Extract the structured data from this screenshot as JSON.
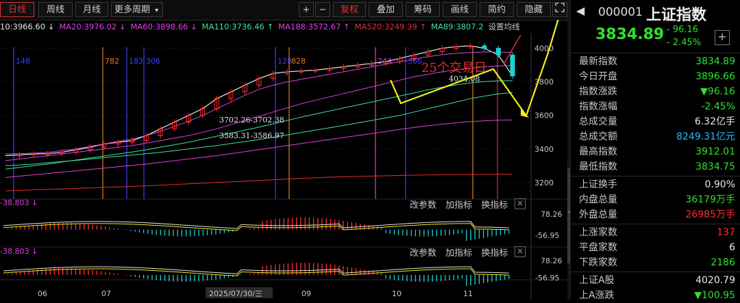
{
  "toolbar": {
    "tabs": [
      "日线",
      "周线",
      "月线",
      "更多周期"
    ],
    "more_arrow": "▾",
    "buttons": [
      "+",
      "−",
      "复权",
      "叠加",
      "筹码",
      "画线",
      "简约",
      "隐藏"
    ],
    "fullscreen_icon": "expand-icon"
  },
  "ma_bar": [
    {
      "text": "10:3966.60 ↓",
      "color": "#e8e8e8"
    },
    {
      "text": "MA20:3976.02 ↓",
      "color": "#e040e0"
    },
    {
      "text": "MA60:3898.66 ↓",
      "color": "#e040e0"
    },
    {
      "text": "MA110:3736.46 ↑",
      "color": "#40e0a0"
    },
    {
      "text": "MA188:3572.67 ↑",
      "color": "#e040e0"
    },
    {
      "text": "MA520:3249.39 ↑",
      "color": "#e03030"
    },
    {
      "text": "MA89:3807.2",
      "color": "#40e0a0"
    },
    {
      "text": "设置均线",
      "color": "#c8c8c8"
    }
  ],
  "chart_data": {
    "type": "line",
    "title": "上证指数",
    "x_ticks": [
      "06",
      "07",
      "2025/07/30/三",
      "09",
      "10",
      "11"
    ],
    "y_ticks": [
      3200,
      3400,
      3600,
      3800,
      4000
    ],
    "ylim": [
      3130,
      4080
    ],
    "series": [
      {
        "name": "上证指数",
        "color": "#e8e8e8",
        "values": [
          3360,
          3365,
          3370,
          3372,
          3380,
          3395,
          3410,
          3430,
          3440,
          3450,
          3480,
          3520,
          3560,
          3600,
          3640,
          3700,
          3740,
          3780,
          3820,
          3850,
          3860,
          3865,
          3870,
          3880,
          3890,
          3900,
          3910,
          3920,
          3940,
          3960,
          3980,
          4000,
          4010,
          4015,
          4000,
          3960,
          3834.89
        ]
      },
      {
        "name": "MA20",
        "color": "#e040e0",
        "values": [
          3370,
          3372,
          3375,
          3380,
          3390,
          3400,
          3415,
          3430,
          3445,
          3460,
          3480,
          3505,
          3535,
          3565,
          3600,
          3640,
          3680,
          3720,
          3755,
          3780,
          3800,
          3815,
          3830,
          3845,
          3860,
          3875,
          3890,
          3905,
          3920,
          3935,
          3950,
          3962,
          3970,
          3975,
          3978,
          3977,
          3976
        ]
      },
      {
        "name": "MA60",
        "color": "#e040e0",
        "values": [
          3330,
          3340,
          3350,
          3360,
          3370,
          3380,
          3390,
          3400,
          3410,
          3420,
          3435,
          3450,
          3465,
          3480,
          3500,
          3520,
          3545,
          3570,
          3595,
          3620,
          3645,
          3670,
          3690,
          3710,
          3730,
          3750,
          3770,
          3790,
          3810,
          3830,
          3845,
          3860,
          3872,
          3882,
          3890,
          3895,
          3898.66
        ]
      },
      {
        "name": "MA110",
        "color": "#40e0a0",
        "values": [
          3300,
          3305,
          3310,
          3318,
          3325,
          3332,
          3340,
          3348,
          3356,
          3364,
          3372,
          3380,
          3390,
          3400,
          3410,
          3420,
          3432,
          3444,
          3456,
          3470,
          3484,
          3498,
          3512,
          3526,
          3540,
          3555,
          3570,
          3585,
          3600,
          3620,
          3640,
          3660,
          3680,
          3700,
          3715,
          3728,
          3736.46
        ]
      },
      {
        "name": "MA188",
        "color": "#e040e0",
        "values": [
          3230,
          3238,
          3246,
          3254,
          3262,
          3270,
          3278,
          3286,
          3294,
          3302,
          3310,
          3320,
          3330,
          3340,
          3350,
          3360,
          3372,
          3384,
          3396,
          3408,
          3420,
          3432,
          3444,
          3456,
          3468,
          3480,
          3492,
          3504,
          3516,
          3528,
          3538,
          3548,
          3556,
          3563,
          3568,
          3571,
          3572.67
        ]
      },
      {
        "name": "MA520",
        "color": "#e03030",
        "values": [
          3150,
          3153,
          3156,
          3159,
          3162,
          3165,
          3168,
          3171,
          3174,
          3177,
          3180,
          3184,
          3188,
          3192,
          3196,
          3200,
          3204,
          3208,
          3212,
          3216,
          3220,
          3224,
          3228,
          3232,
          3234,
          3236,
          3238,
          3240,
          3242,
          3244,
          3245,
          3246,
          3247,
          3248,
          3248.5,
          3249,
          3249.39
        ]
      },
      {
        "name": "MA89",
        "color": "#40e0a0",
        "values": [
          3280,
          3290,
          3300,
          3310,
          3322,
          3334,
          3346,
          3358,
          3370,
          3382,
          3395,
          3410,
          3425,
          3440,
          3458,
          3476,
          3494,
          3512,
          3530,
          3550,
          3570,
          3590,
          3608,
          3626,
          3644,
          3662,
          3680,
          3698,
          3716,
          3734,
          3752,
          3768,
          3782,
          3794,
          3802,
          3806,
          3807.2
        ]
      }
    ],
    "vertical_markers": [
      {
        "label": "148",
        "color": "#4040ff"
      },
      {
        "label": "782",
        "color": "#e08020"
      },
      {
        "label": "183",
        "color": "#4040ff"
      },
      {
        "label": "306",
        "color": "#4040ff"
      },
      {
        "label": "128",
        "color": "#4040ff"
      },
      {
        "label": "828",
        "color": "#e08020"
      },
      {
        "label": "244",
        "color": "#e040e0"
      },
      {
        "label": "366",
        "color": "#4040ff"
      },
      {
        "label": "",
        "color": "#e08020"
      },
      {
        "label": "",
        "color": "#e03030"
      }
    ],
    "annotations": [
      "3702.26-3702.38",
      "3583.31-3586.97",
      "4034.08",
      "25个交易日"
    ]
  },
  "sub1": {
    "value": "-38.803 ↓",
    "tools": [
      "改参数",
      "加指标",
      "换指标"
    ],
    "close": "×",
    "y_top": "78.26",
    "y_bottom": "-56.95"
  },
  "sub2": {
    "value": "-38.803 ↓",
    "tools": [
      "改参数",
      "加指标",
      "换指标"
    ],
    "close": "×",
    "y_top": "78.26",
    "y_bottom": "-56.95"
  },
  "panel": {
    "code": "000001",
    "name": "上证指数",
    "price": "3834.89",
    "change": "- 96.16",
    "change_pct": "- 2.45%",
    "add_icon": "plus-icon",
    "rows_a": [
      {
        "label": "最新指数",
        "value": "3834.89",
        "color": "#30e030"
      },
      {
        "label": "今日开盘",
        "value": "3896.66",
        "color": "#30e030"
      },
      {
        "label": "指数涨跌",
        "value": "▼96.16",
        "color": "#30e030"
      },
      {
        "label": "指数涨幅",
        "value": "-2.45%",
        "color": "#30e030"
      },
      {
        "label": "总成交量",
        "value": "6.32亿手",
        "color": "#e8e8e8"
      },
      {
        "label": "总成交额",
        "value": "8249.31亿元",
        "color": "#20c0ff"
      },
      {
        "label": "最高指数",
        "value": "3912.01",
        "color": "#30e030"
      },
      {
        "label": "最低指数",
        "value": "3834.75",
        "color": "#30e030"
      }
    ],
    "rows_b": [
      {
        "label": "上证换手",
        "value": "0.90%",
        "color": "#e8e8e8"
      },
      {
        "label": "内盘总量",
        "value": "36179万手",
        "color": "#30e030"
      },
      {
        "label": "外盘总量",
        "value": "26985万手",
        "color": "#ff3030"
      }
    ],
    "rows_c": [
      {
        "label": "上涨家数",
        "value": "137",
        "color": "#ff3030"
      },
      {
        "label": "平盘家数",
        "value": "6",
        "color": "#e8e8e8"
      },
      {
        "label": "下跌家数",
        "value": "2186",
        "color": "#30e030"
      }
    ],
    "rows_d": [
      {
        "label": "上证A股",
        "value": "4020.79",
        "color": "#e8e8e8"
      },
      {
        "label": "上A涨跌",
        "value": "▼100.95",
        "color": "#30e030"
      }
    ]
  }
}
